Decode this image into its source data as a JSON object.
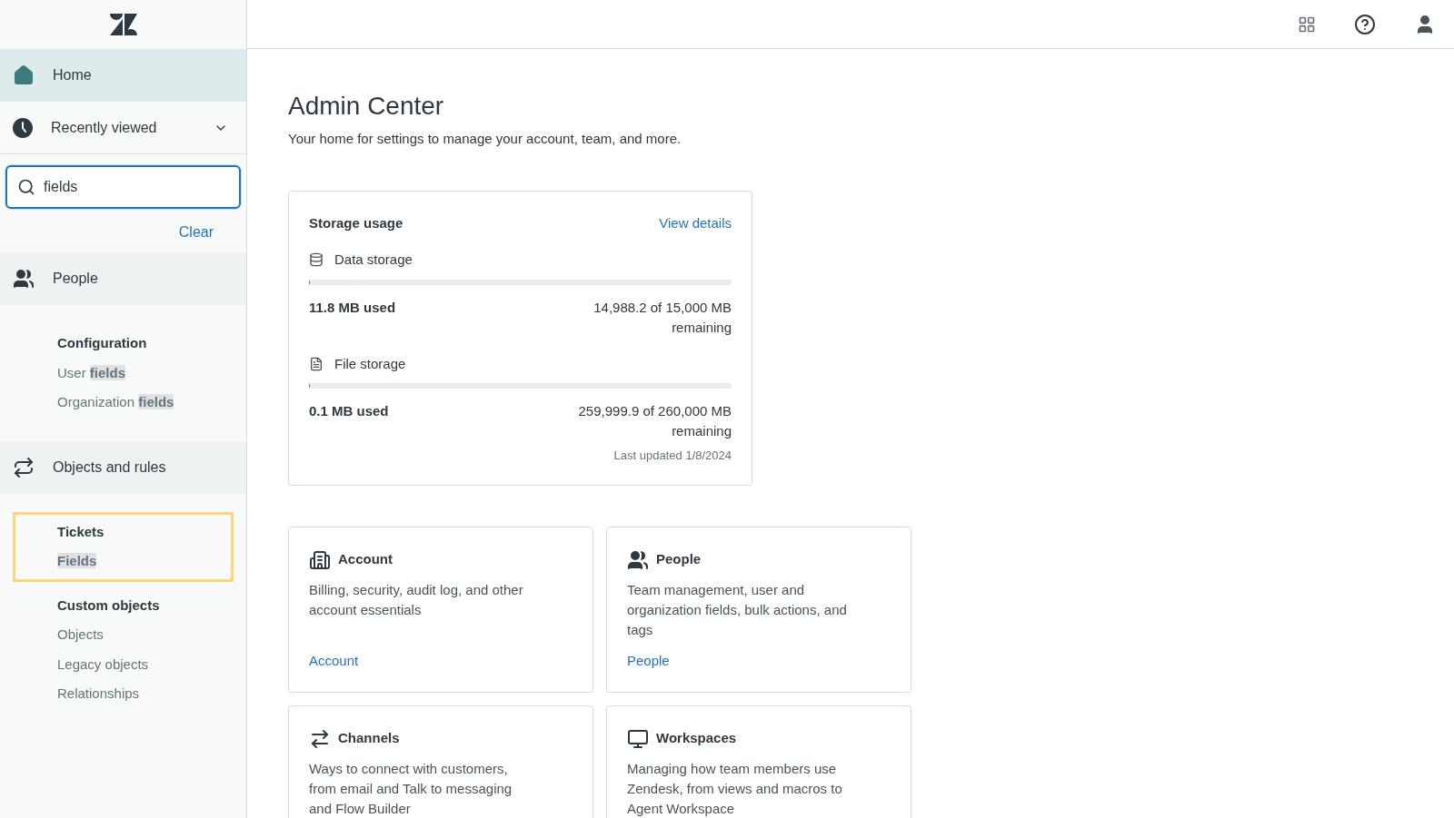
{
  "sidebar": {
    "nav": [
      {
        "kind": "home",
        "label": "Home",
        "selected": true
      },
      {
        "kind": "recent",
        "label": "Recently viewed",
        "expanded": false
      }
    ],
    "search": {
      "value": "fields",
      "clear": "Clear"
    },
    "sections": [
      {
        "kind": "people",
        "label": "People",
        "groups": [
          {
            "title": "Configuration",
            "outlined": false,
            "items": [
              {
                "segments": [
                  {
                    "text": "User ",
                    "highlighted": false
                  },
                  {
                    "text": "fields",
                    "highlighted": true
                  }
                ]
              },
              {
                "segments": [
                  {
                    "text": "Organization ",
                    "highlighted": false
                  },
                  {
                    "text": "fields",
                    "highlighted": true
                  }
                ]
              }
            ]
          }
        ]
      },
      {
        "kind": "objects",
        "label": "Objects and rules",
        "groups": [
          {
            "title": "Tickets",
            "outlined": true,
            "items": [
              {
                "segments": [
                  {
                    "text": "Fields",
                    "highlighted": true
                  }
                ]
              }
            ]
          },
          {
            "title": "Custom objects",
            "outlined": false,
            "items": [
              {
                "segments": [
                  {
                    "text": "Objects",
                    "highlighted": false
                  }
                ]
              },
              {
                "segments": [
                  {
                    "text": "Legacy objects",
                    "highlighted": false
                  }
                ]
              },
              {
                "segments": [
                  {
                    "text": "Relationships",
                    "highlighted": false
                  }
                ]
              }
            ]
          }
        ]
      }
    ]
  },
  "main": {
    "title": "Admin Center",
    "subtitle": "Your home for settings to manage your account, team, and more.",
    "storage": {
      "title": "Storage usage",
      "link": "View details",
      "items": [
        {
          "kind": "data",
          "label": "Data storage",
          "level": 0.001,
          "used": "11.8 MB used",
          "remaining": "14,988.2 of 15,000 MB remaining"
        },
        {
          "kind": "file",
          "label": "File storage",
          "level": 0,
          "used": "0.1 MB used",
          "remaining": "259,999.9 of 260,000 MB remaining"
        }
      ],
      "updated": "Last updated 1/8/2024"
    },
    "cards": [
      {
        "kind": "account",
        "title": "Account",
        "description": "Billing, security, audit log, and other account essentials",
        "link": "Account"
      },
      {
        "kind": "people",
        "title": "People",
        "description": "Team management, user and organization fields, bulk actions, and tags",
        "link": "People"
      },
      {
        "kind": "channels",
        "title": "Channels",
        "description": "Ways to connect with customers, from email and Talk to messaging and Flow Builder"
      },
      {
        "kind": "workspaces",
        "title": "Workspaces",
        "description": "Managing how team members use Zendesk, from views and macros to Agent Workspace"
      }
    ]
  }
}
